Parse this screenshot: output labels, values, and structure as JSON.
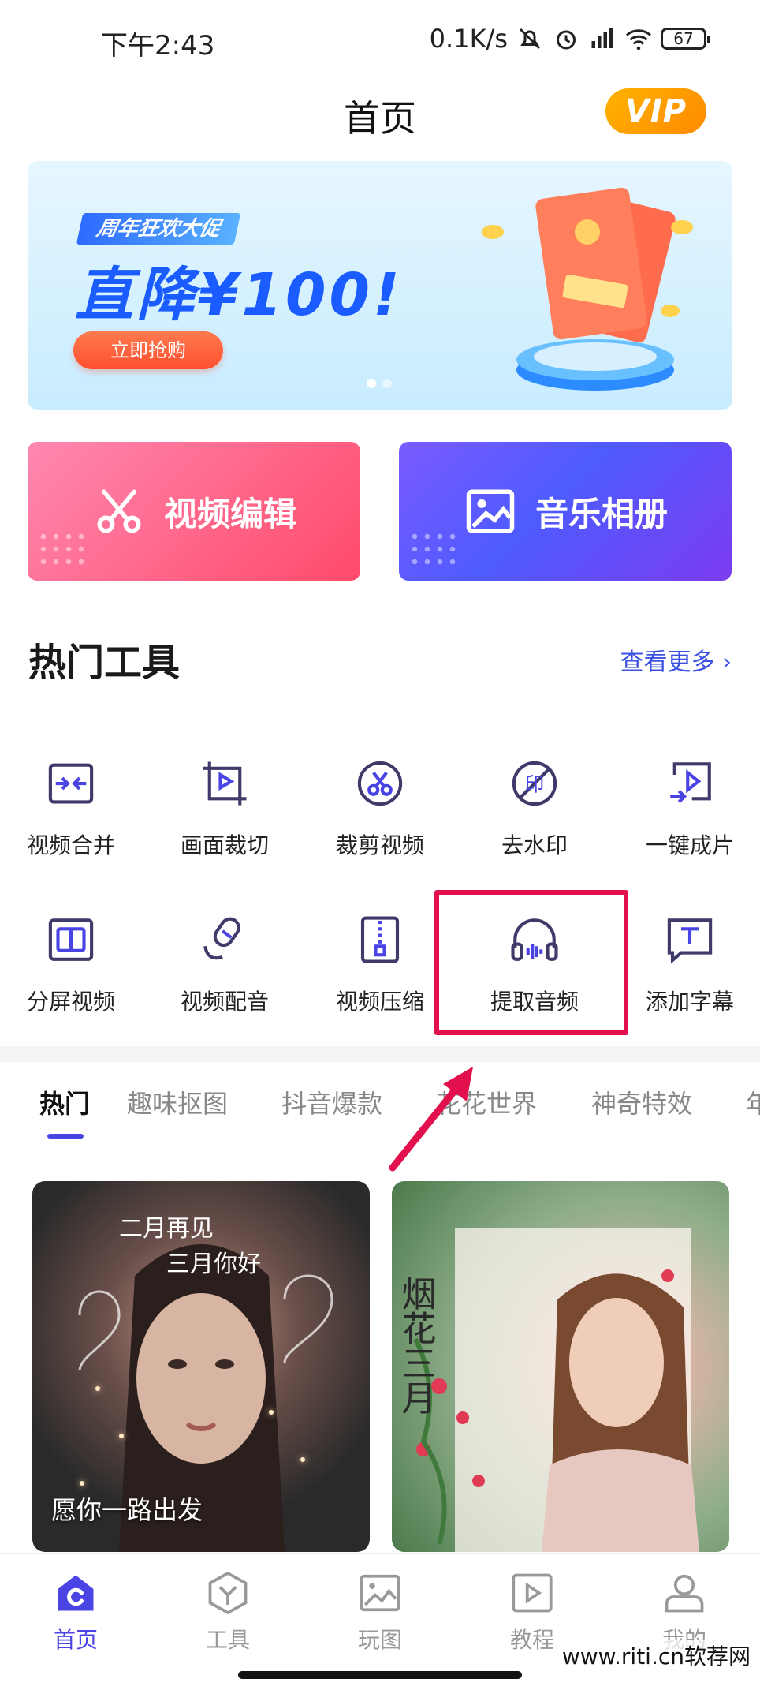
{
  "status_bar": {
    "time": "下午2:43",
    "network_speed": "0.1K/s",
    "battery": "67"
  },
  "header": {
    "title": "首页",
    "vip_label": "VIP"
  },
  "banner": {
    "tag": "周年狂欢大促",
    "headline": "直降¥100!",
    "cta": "立即抢购",
    "slides": 2,
    "active_slide": 1
  },
  "quick_cards": {
    "video_edit": "视频编辑",
    "music_album": "音乐相册"
  },
  "hot_tools": {
    "title": "热门工具",
    "view_more": "查看更多",
    "row1": [
      "视频合并",
      "画面裁切",
      "裁剪视频",
      "去水印",
      "一键成片"
    ],
    "row2": [
      "分屏视频",
      "视频配音",
      "视频压缩",
      "提取音频",
      "添加字幕"
    ],
    "highlighted": "提取音频"
  },
  "category_tabs": {
    "items": [
      "热门",
      "趣味抠图",
      "抖音爆款",
      "花花世界",
      "神奇特效",
      "年"
    ],
    "active": "热门"
  },
  "content_cards": [
    {
      "caption": "愿你一路出发"
    },
    {
      "caption": ""
    }
  ],
  "bottom_nav": {
    "items": [
      "首页",
      "工具",
      "玩图",
      "教程",
      "我的"
    ],
    "active": "首页"
  },
  "watermark": "www.riti.cn软荐网",
  "colors": {
    "accent": "#4a44e4",
    "highlight": "#e3104e",
    "link": "#3b52e0"
  }
}
